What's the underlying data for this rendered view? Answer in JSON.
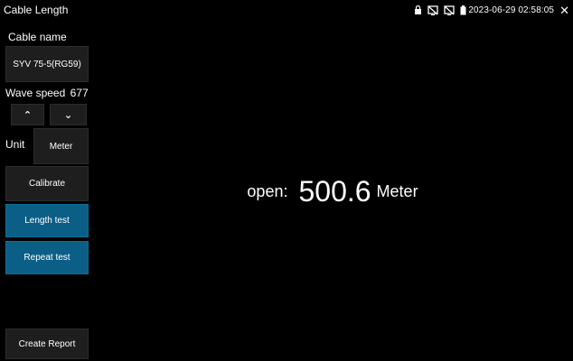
{
  "window": {
    "title": "Cable Length",
    "datetime": "2023-06-29 02:58:05"
  },
  "status_icons": [
    "lock-icon",
    "no-signal-icon",
    "no-signal-icon",
    "battery-icon",
    "close-icon"
  ],
  "sidebar": {
    "cable_name_label": "Cable name",
    "cable_name_value": "SYV 75-5(RG59)",
    "wave_speed_label": "Wave speed",
    "wave_speed_value": "677",
    "unit_label": "Unit",
    "unit_value": "Meter",
    "calibrate_label": "Calibrate",
    "length_test_label": "Length test",
    "repeat_test_label": "Repeat test",
    "create_report_label": "Create Report"
  },
  "readout": {
    "status": "open:",
    "value": "500.6",
    "unit": "Meter"
  },
  "colors": {
    "accent_button": "#0b5f86",
    "background": "#000000",
    "button": "#1e1e1e"
  }
}
